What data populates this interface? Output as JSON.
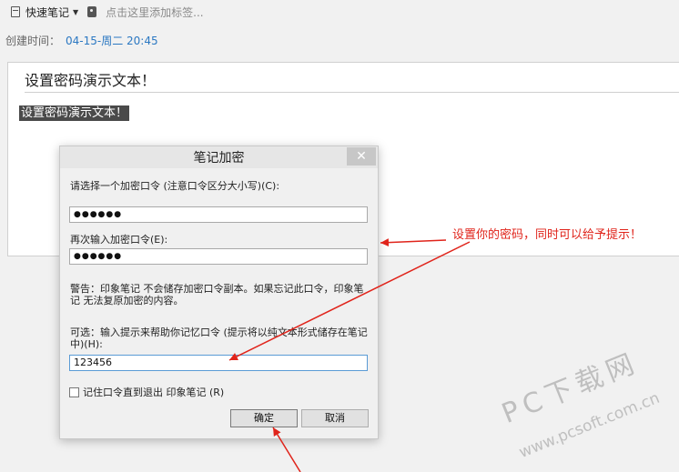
{
  "toolbar": {
    "notebook_label": "快速笔记",
    "tag_placeholder": "点击这里添加标签..."
  },
  "meta": {
    "created_label": "创建时间：",
    "created_value": "04-15-周二 20:45"
  },
  "note": {
    "title": "设置密码演示文本！",
    "body": "设置密码演示文本！"
  },
  "dialog": {
    "title": "笔记加密",
    "close_glyph": "✕",
    "password_label": "请选择一个加密口令 (注意口令区分大小写)(C):",
    "password_value": "●●●●●●",
    "confirm_label": "再次输入加密口令(E):",
    "confirm_value": "●●●●●●",
    "warning": "警告：印象笔记 不会储存加密口令副本。如果忘记此口令，印象笔记 无法复原加密的内容。",
    "hint_label": "可选：输入提示来帮助你记忆口令 (提示将以纯文本形式储存在笔记中)(H):",
    "hint_value": "123456",
    "remember_label": "记住口令直到退出 印象笔记 (R)",
    "remember_checked": false,
    "ok_label": "确定",
    "cancel_label": "取消"
  },
  "annotation": {
    "text": "设置你的密码，同时可以给予提示！",
    "color": "#e0241b"
  },
  "watermark": {
    "main": "PC下载网",
    "url": "www.pcsoft.com.cn"
  }
}
